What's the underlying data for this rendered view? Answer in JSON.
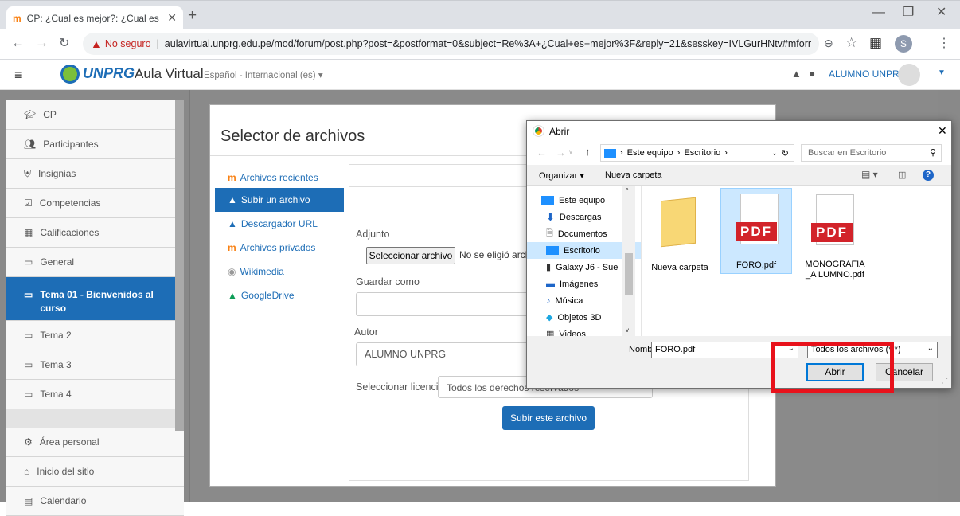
{
  "browser": {
    "tab_title": "CP: ¿Cual es mejor?: ¿Cual es mej",
    "security_label": "No seguro",
    "url": "aulavirtual.unprg.edu.pe/mod/forum/post.php?post=&postformat=0&subject=Re%3A+¿Cual+es+mejor%3F&reply=21&sesskey=IVLGurHNtv#mformf...",
    "profile_initial": "S"
  },
  "site": {
    "logo": "UNPRG",
    "name": "Aula Virtual",
    "language": "Español - Internacional (es) ▾",
    "user": "ALUMNO UNPRG"
  },
  "drawer": {
    "items": [
      {
        "label": "CP",
        "icon": "graduation-cap-icon"
      },
      {
        "label": "Participantes",
        "icon": "users-icon"
      },
      {
        "label": "Insignias",
        "icon": "shield-icon"
      },
      {
        "label": "Competencias",
        "icon": "checkbox-icon"
      },
      {
        "label": "Calificaciones",
        "icon": "table-icon"
      },
      {
        "label": "General",
        "icon": "folder-icon"
      },
      {
        "label": "Tema 01 - Bienvenidos al curso",
        "icon": "folder-icon"
      },
      {
        "label": "Tema 2",
        "icon": "folder-icon"
      },
      {
        "label": "Tema 3",
        "icon": "folder-icon"
      },
      {
        "label": "Tema 4",
        "icon": "folder-icon"
      },
      {
        "label": "Área personal",
        "icon": "dashboard-icon"
      },
      {
        "label": "Inicio del sitio",
        "icon": "home-icon"
      },
      {
        "label": "Calendario",
        "icon": "calendar-icon"
      }
    ]
  },
  "picker": {
    "title": "Selector de archivos",
    "repos": [
      "Archivos recientes",
      "Subir un archivo",
      "Descargador URL",
      "Archivos privados",
      "Wikimedia",
      "GoogleDrive"
    ],
    "adjunto_label": "Adjunto",
    "choose_button": "Seleccionar archivo",
    "no_file_text": "No se eligió arch",
    "guardar_label": "Guardar como",
    "autor_label": "Autor",
    "autor_value": "ALUMNO UNPRG",
    "license_label": "Seleccionar licencia",
    "license_value": "Todos los derechos reservados",
    "upload_button": "Subir este archivo"
  },
  "dialog": {
    "title": "Abrir",
    "breadcrumb": [
      "Este equipo",
      "Escritorio"
    ],
    "search_placeholder": "Buscar en Escritorio",
    "organize": "Organizar ▾",
    "new_folder": "Nueva carpeta",
    "tree": [
      "Este equipo",
      "Descargas",
      "Documentos",
      "Escritorio",
      "Galaxy J6 - Sue",
      "Imágenes",
      "Música",
      "Objetos 3D",
      "Videos"
    ],
    "files": [
      {
        "name": "Nueva carpeta",
        "type": "folder"
      },
      {
        "name": "FORO.pdf",
        "type": "pdf"
      },
      {
        "name": "MONOGRAFIA_A LUMNO.pdf",
        "type": "pdf"
      }
    ],
    "pdf_badge": "PDF",
    "filename_label": "Nombre:",
    "filename_value": "FORO.pdf",
    "filter_value": "Todos los archivos (*.*)",
    "open_button": "Abrir",
    "cancel_button": "Cancelar"
  },
  "colors": {
    "moodle_blue": "#1d6db6",
    "highlight_red": "#e8111b",
    "pdf_red": "#d2232a"
  }
}
